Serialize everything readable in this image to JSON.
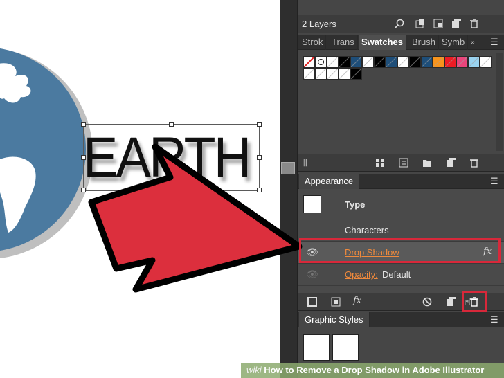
{
  "canvas": {
    "artwork_text": "EARTH",
    "colors": {
      "globe": "#4b7aa0",
      "arrow_fill": "#dc2f3d",
      "arrow_stroke": "#000000"
    }
  },
  "layers_panel": {
    "count_label": "2 Layers",
    "icons": [
      "search-icon",
      "locate-icon",
      "sublayer-icon",
      "new-layer-icon",
      "trash-icon"
    ]
  },
  "swatches_panel": {
    "tabs": [
      {
        "label": "Strok",
        "active": false
      },
      {
        "label": "Trans",
        "active": false
      },
      {
        "label": "Swatches",
        "active": true
      },
      {
        "label": "Brush",
        "active": false
      },
      {
        "label": "Symb",
        "active": false
      }
    ],
    "menu_icon": "panel-menu-icon",
    "swatches_row1": [
      "none",
      "registration",
      "#ffffff",
      "#000000",
      "#1e4e79",
      "#ffffff",
      "#000000",
      "#1e4e79",
      "#ffffff",
      "#000000",
      "#1e4e79",
      "#f7941d",
      "#ed1c24",
      "#e8457c",
      "#9ad3f0",
      "#ffffff"
    ],
    "swatches_row2": [
      "#ffffff",
      "#ffffff",
      "#ffffff",
      "#ffffff",
      "#000000"
    ]
  },
  "appearance_panel": {
    "tab_label": "Appearance",
    "rows": {
      "type": "Type",
      "characters": "Characters",
      "drop_shadow": "Drop Shadow",
      "fx": "fx",
      "opacity_label": "Opacity:",
      "opacity_value": "Default"
    },
    "footer_fx": "fx"
  },
  "graphic_styles_panel": {
    "tab_label": "Graphic Styles"
  },
  "watermark": {
    "wiki": "wiki",
    "text": "How to Remove a Drop Shadow in Adobe Illustrator"
  }
}
